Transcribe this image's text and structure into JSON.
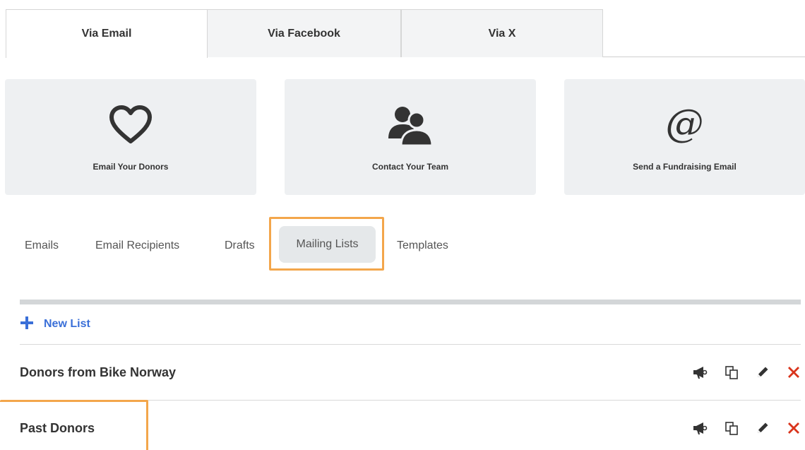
{
  "channel_tabs": [
    {
      "label": "Via Email",
      "active": true
    },
    {
      "label": "Via Facebook",
      "active": false
    },
    {
      "label": "Via X",
      "active": false
    }
  ],
  "cards": [
    {
      "label": "Email Your Donors",
      "icon": "heart-icon"
    },
    {
      "label": "Contact Your Team",
      "icon": "team-icon"
    },
    {
      "label": "Send a Fundraising Email",
      "icon": "at-icon",
      "glyph": "@"
    }
  ],
  "subnav": {
    "emails": "Emails",
    "email_recipients": "Email Recipients",
    "drafts": "Drafts",
    "mailing_lists": "Mailing Lists",
    "templates": "Templates",
    "active": "Mailing Lists"
  },
  "new_list_label": "New List",
  "mailing_lists": [
    {
      "name": "Donors from Bike Norway"
    },
    {
      "name": "Past Donors"
    }
  ],
  "row_actions": [
    "megaphone-icon",
    "copy-icon",
    "pencil-icon",
    "delete-icon"
  ],
  "colors": {
    "accent": "#3a6fd8",
    "highlight": "#f3a64b",
    "delete": "#d9341c",
    "card_bg": "#eef0f2"
  }
}
